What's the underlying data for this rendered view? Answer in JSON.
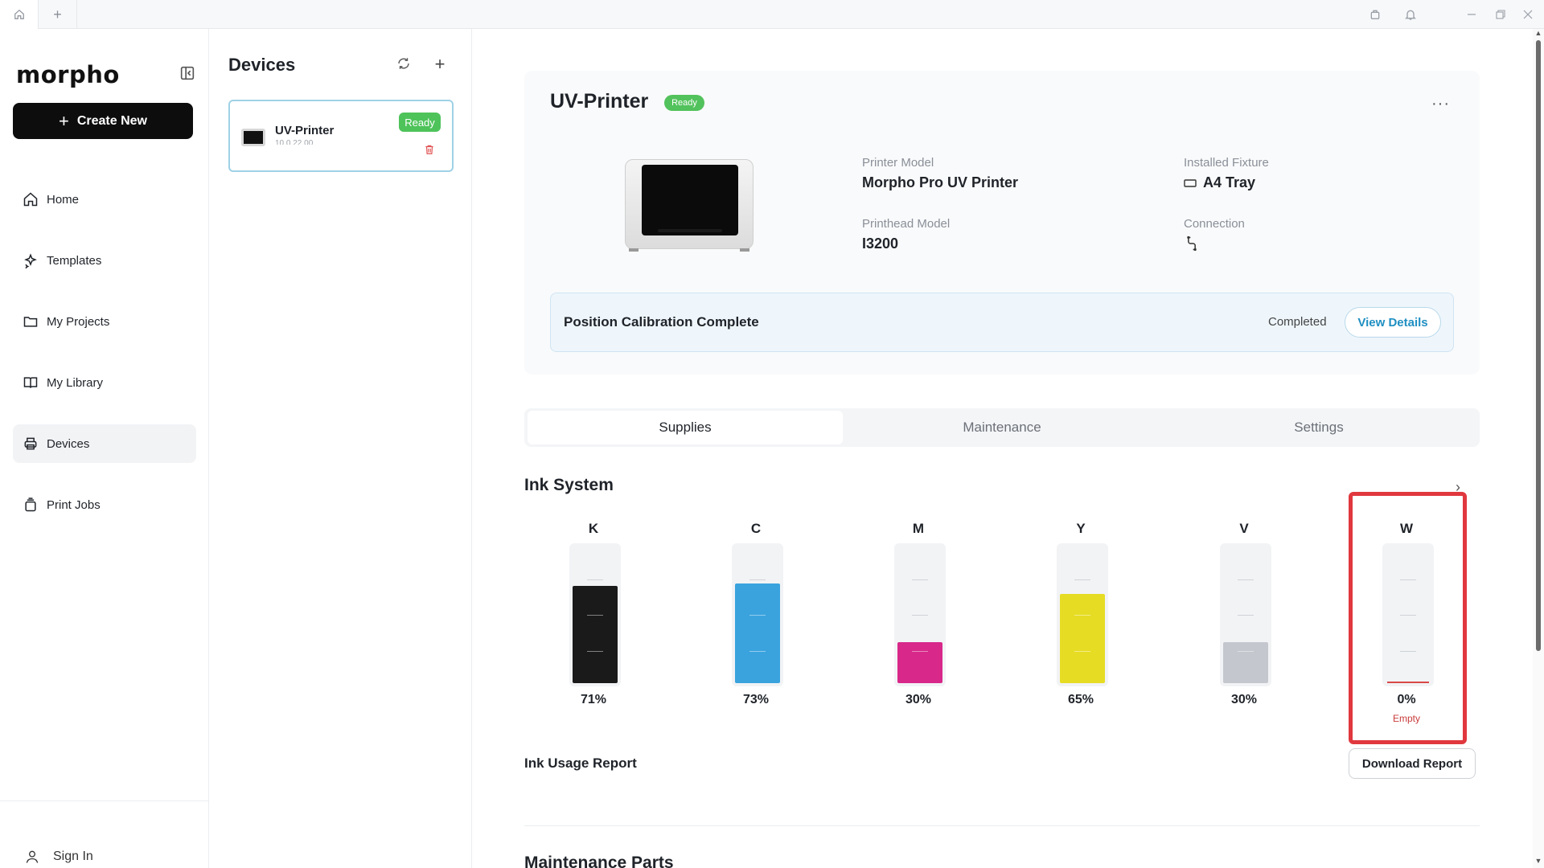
{
  "titlebar": {
    "home_icon": "home-icon",
    "add_tab_label": "+"
  },
  "sidebar": {
    "logo": "morpho",
    "create_new_label": "Create New",
    "items": [
      {
        "label": "Home",
        "icon": "home-icon"
      },
      {
        "label": "Templates",
        "icon": "sparkle-icon"
      },
      {
        "label": "My Projects",
        "icon": "folder-icon"
      },
      {
        "label": "My Library",
        "icon": "book-icon"
      },
      {
        "label": "Devices",
        "icon": "printer-icon",
        "active": true
      },
      {
        "label": "Print Jobs",
        "icon": "print-jobs-icon"
      }
    ],
    "sign_in_label": "Sign In"
  },
  "devices": {
    "title": "Devices",
    "add_label": "+",
    "list": [
      {
        "name": "UV-Printer",
        "ip": "10.0.22.00",
        "status": "Ready"
      }
    ]
  },
  "printer": {
    "name": "UV-Printer",
    "status": "Ready",
    "more_label": "···",
    "printer_model_label": "Printer Model",
    "printer_model": "Morpho Pro UV Printer",
    "installed_fixture_label": "Installed Fixture",
    "installed_fixture": "A4 Tray",
    "printhead_model_label": "Printhead Model",
    "printhead_model": "I3200",
    "connection_label": "Connection",
    "calibration": {
      "title": "Position Calibration Complete",
      "status": "Completed",
      "button_label": "View Details"
    }
  },
  "tabs": [
    {
      "label": "Supplies",
      "active": true
    },
    {
      "label": "Maintenance",
      "active": false
    },
    {
      "label": "Settings",
      "active": false
    }
  ],
  "ink_system": {
    "title": "Ink System",
    "chevron": "›",
    "inks": [
      {
        "channel": "K",
        "level": 71,
        "label": "71%",
        "color": "#1a1a1a"
      },
      {
        "channel": "C",
        "level": 73,
        "label": "73%",
        "color": "#3aa3de"
      },
      {
        "channel": "M",
        "level": 30,
        "label": "30%",
        "color": "#d8288a"
      },
      {
        "channel": "Y",
        "level": 65,
        "label": "65%",
        "color": "#e6dc24"
      },
      {
        "channel": "V",
        "level": 30,
        "label": "30%",
        "color": "#c4c8ce"
      },
      {
        "channel": "W",
        "level": 0,
        "label": "0%",
        "color": "#ffffff",
        "status": "Empty"
      }
    ],
    "usage_report_label": "Ink Usage Report",
    "download_button_label": "Download Report"
  },
  "maintenance_parts": {
    "title": "Maintenance Parts"
  },
  "colors": {
    "accent": "#1f8fc2",
    "ready_green": "#4ec35a",
    "highlight_red": "#e0383e"
  }
}
